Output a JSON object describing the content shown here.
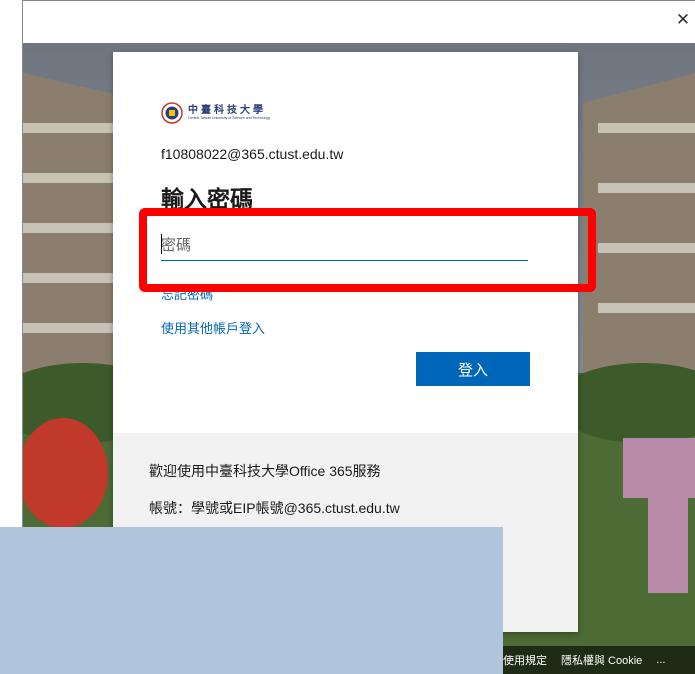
{
  "window": {
    "close_glyph": "✕"
  },
  "signin": {
    "logo": {
      "zh": "中臺科技大學",
      "en": "Central Taiwan University of Science and Technology"
    },
    "identity": "f10808022@365.ctust.edu.tw",
    "heading": "輸入密碼",
    "password_placeholder": "密碼",
    "forgot_link": "忘記密碼",
    "other_account_link": "使用其他帳戶登入",
    "signin_button": "登入",
    "welcome_text": "歡迎使用中臺科技大學Office 365服務",
    "account_hint": "帳號：學號或EIP帳號@365.ctust.edu.tw"
  },
  "bottom_bar": {
    "terms": "使用規定",
    "privacy": "隱私權與 Cookie",
    "more": "..."
  },
  "colors": {
    "accent": "#0067b8",
    "highlight": "#ff0000",
    "occluder": "#b0c4dc"
  }
}
